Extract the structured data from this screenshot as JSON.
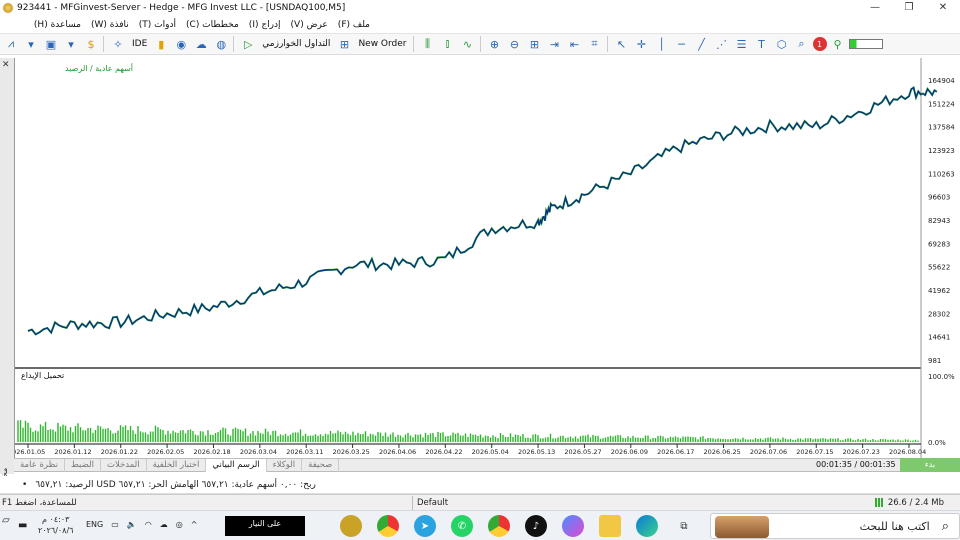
{
  "window": {
    "title": "923441 - MFGinvest-Server - Hedge - MFG Invest LLC - [USNDAQ100,M5]",
    "minimize": "—",
    "restore": "❐",
    "close": "✕"
  },
  "menu": [
    "ملف (F)",
    "عرض (V)",
    "إدراج (I)",
    "مخططات (C)",
    "أدوات (T)",
    "نافذة (W)",
    "مساعدة (H)"
  ],
  "toolbar": {
    "ide": "IDE",
    "algo": "التداول الخوارزمي",
    "new_order": "New Order",
    "alert_count": "1"
  },
  "chart": {
    "label": "أسهم عادية / الرصيد",
    "sub_label": "تحميل الإيداع",
    "close": "✕"
  },
  "chart_data": [
    {
      "type": "line",
      "series": [
        {
          "name": "أسهم عادية",
          "color": "#1f9a2e"
        },
        {
          "name": "الرصيد",
          "color": "#0a2e8a"
        }
      ],
      "y_ticks": [
        "164904",
        "151224",
        "137584",
        "123923",
        "110263",
        "96603",
        "82943",
        "69283",
        "55622",
        "41962",
        "28302",
        "14641",
        "981"
      ],
      "x_ticks": [
        "2026.01.05",
        "2026.01.12",
        "2026.01.22",
        "2026.02.05",
        "2026.02.18",
        "2026.03.04",
        "2026.03.11",
        "2026.03.25",
        "2026.04.06",
        "2026.04.22",
        "2026.05.04",
        "2026.05.13",
        "2026.05.27",
        "2026.06.09",
        "2026.06.17",
        "2026.06.25",
        "2026.07.06",
        "2026.07.15",
        "2026.07.23",
        "2026.08.04"
      ],
      "points": [
        [
          0,
          18000
        ],
        [
          1,
          22000
        ],
        [
          2,
          23000
        ],
        [
          3,
          28000
        ],
        [
          4,
          32000
        ],
        [
          5,
          40000
        ],
        [
          6,
          47000
        ],
        [
          7,
          57000
        ],
        [
          8,
          57000
        ],
        [
          9,
          60000
        ],
        [
          10,
          78000
        ],
        [
          11,
          82000
        ],
        [
          11.3,
          90000
        ],
        [
          12,
          98000
        ],
        [
          13,
          110000
        ],
        [
          14,
          125000
        ],
        [
          15,
          133000
        ],
        [
          16,
          138000
        ],
        [
          17,
          138000
        ],
        [
          18,
          147000
        ],
        [
          19,
          158000
        ],
        [
          19.6,
          158000
        ]
      ],
      "ylim": [
        981,
        164904
      ]
    },
    {
      "type": "bar",
      "title": "تحميل الإيداع",
      "y_ticks": [
        "100.0%",
        "0.0%"
      ],
      "ylim": [
        0,
        100
      ],
      "values_start_percent": 25,
      "values_end_percent": 3
    }
  ],
  "tabs": [
    "صحيفة",
    "الوكلاء",
    "الرسم البياني",
    "اختبار الخلفية",
    "المدخلات",
    "الضبط",
    "نظرة عامة"
  ],
  "time": "00:01:35 / 00:01:35",
  "start_button": "بدء",
  "info": {
    "bullet": "•",
    "text": "ربح: ٠,٠٠  أسهم عادية: ٦٥٧,٢١  الهامش الحر: ٦٥٧,٢١  USD الرصيد: ٦٥٧,٢١"
  },
  "status": {
    "help": "F1 للمساعدة، اضغط",
    "profile": "Default",
    "connection": "26.6 / 2.4 Mb"
  },
  "taskbar": {
    "search": "اكتب هنا للبحث",
    "news": "على النيار",
    "lang": "ENG",
    "time": "٠٤:٠٣ م",
    "date": "٢٠٢٦/٠٨/٦"
  },
  "strip": {
    "label": "مختبر الاستراتيجية"
  }
}
